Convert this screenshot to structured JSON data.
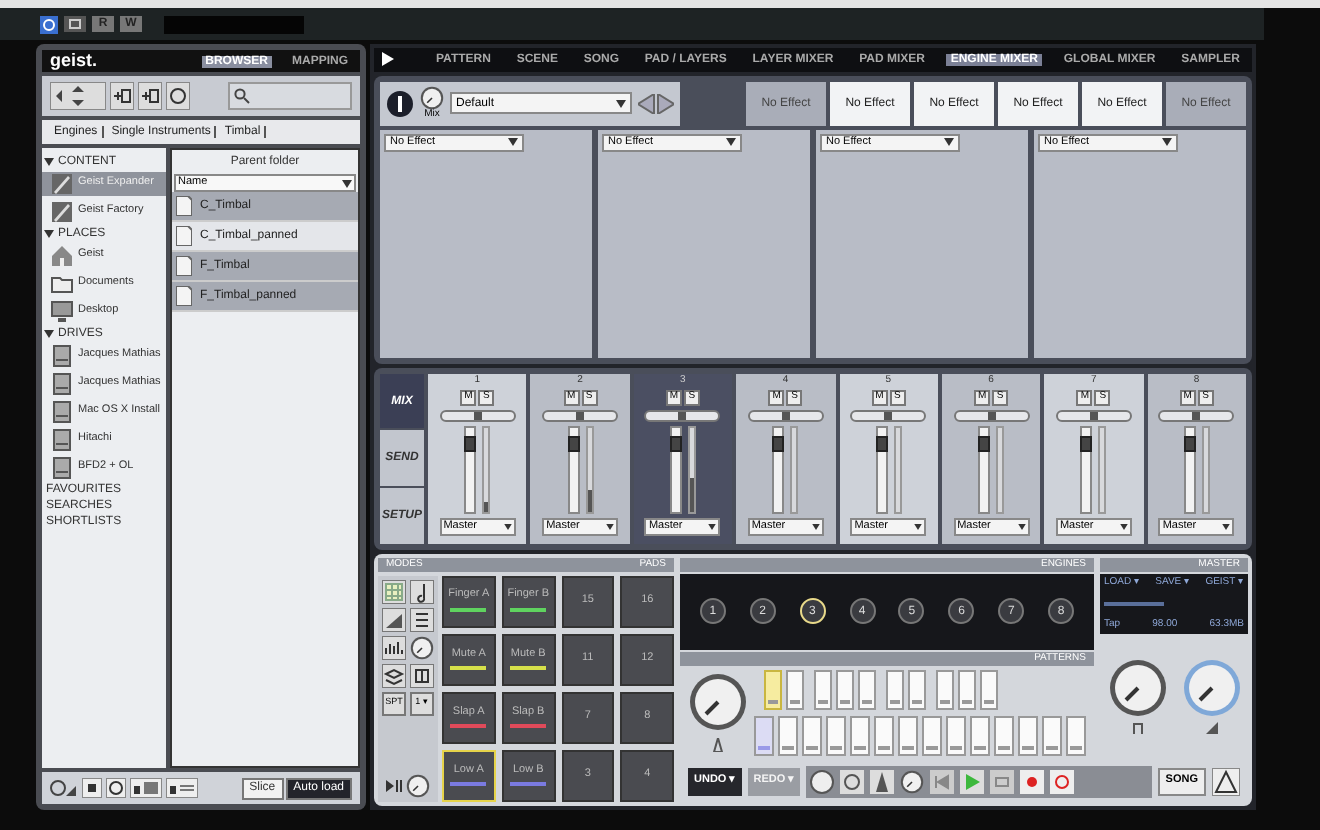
{
  "host_toolbar": {
    "buttons": [
      "R",
      "W"
    ]
  },
  "browser": {
    "logo": "geist.",
    "tabs": [
      {
        "label": "BROWSER",
        "selected": true
      },
      {
        "label": "MAPPING",
        "selected": false
      }
    ],
    "breadcrumbs": [
      "Engines",
      "Single Instruments",
      "Timbal"
    ],
    "sections": [
      {
        "title": "CONTENT",
        "expanded": true,
        "items": [
          {
            "label": "Geist Expander",
            "kind": "content",
            "selected": true
          },
          {
            "label": "Geist Factory",
            "kind": "content",
            "selected": false
          }
        ]
      },
      {
        "title": "PLACES",
        "expanded": true,
        "items": [
          {
            "label": "Geist",
            "kind": "home",
            "selected": false
          },
          {
            "label": "Documents",
            "kind": "folder",
            "selected": false
          },
          {
            "label": "Desktop",
            "kind": "desktop",
            "selected": false
          }
        ]
      },
      {
        "title": "DRIVES",
        "expanded": true,
        "items": [
          {
            "label": "Jacques Mathias",
            "kind": "drive",
            "selected": false
          },
          {
            "label": "Jacques Mathias",
            "kind": "drive",
            "selected": false
          },
          {
            "label": "Mac OS X Install",
            "kind": "drive",
            "selected": false
          },
          {
            "label": "Hitachi",
            "kind": "drive",
            "selected": false
          },
          {
            "label": "BFD2 + OL",
            "kind": "drive",
            "selected": false
          }
        ]
      },
      {
        "title": "FAVOURITES",
        "expanded": false
      },
      {
        "title": "SEARCHES",
        "expanded": false
      },
      {
        "title": "SHORTLISTS",
        "expanded": false
      }
    ],
    "file_list": {
      "header": "Parent folder",
      "sort": "Name",
      "files": [
        {
          "name": "C_Timbal",
          "selected": true
        },
        {
          "name": "C_Timbal_panned",
          "selected": false
        },
        {
          "name": "F_Timbal",
          "selected": true
        },
        {
          "name": "F_Timbal_panned",
          "selected": true
        }
      ]
    },
    "footer_buttons": [
      {
        "label": "Slice",
        "on": false
      },
      {
        "label": "Auto load",
        "on": true
      }
    ]
  },
  "main_tabs": [
    {
      "label": "PATTERN",
      "selected": false
    },
    {
      "label": "SCENE",
      "selected": false
    },
    {
      "label": "SONG",
      "selected": false
    },
    {
      "label": "PAD / LAYERS",
      "selected": false
    },
    {
      "label": "LAYER MIXER",
      "selected": false
    },
    {
      "label": "PAD MIXER",
      "selected": false
    },
    {
      "label": "ENGINE MIXER",
      "selected": true
    },
    {
      "label": "GLOBAL MIXER",
      "selected": false
    },
    {
      "label": "SAMPLER",
      "selected": false
    }
  ],
  "effects": {
    "mix_label": "Mix",
    "preset": "Default",
    "slots": [
      {
        "label": "No Effect",
        "selected": true
      },
      {
        "label": "No Effect",
        "selected": false
      },
      {
        "label": "No Effect",
        "selected": false
      },
      {
        "label": "No Effect",
        "selected": false
      },
      {
        "label": "No Effect",
        "selected": false
      },
      {
        "label": "No Effect",
        "selected": true
      }
    ],
    "panels": [
      {
        "effect": "No Effect"
      },
      {
        "effect": "No Effect"
      },
      {
        "effect": "No Effect"
      },
      {
        "effect": "No Effect"
      }
    ]
  },
  "mixer": {
    "side_tabs": [
      {
        "label": "MIX",
        "selected": true
      },
      {
        "label": "SEND",
        "selected": false
      },
      {
        "label": "SETUP",
        "selected": false
      }
    ],
    "channels": [
      {
        "number": "1",
        "mute": "M",
        "solo": "S",
        "output": "Master",
        "selected": false,
        "pan": {
          "level": 0.5
        },
        "fader": {
          "level": 0.8
        },
        "meter": {
          "level": 0.12
        }
      },
      {
        "number": "2",
        "mute": "M",
        "solo": "S",
        "output": "Master",
        "selected": false,
        "pan": {
          "level": 0.5
        },
        "fader": {
          "level": 0.8
        },
        "meter": {
          "level": 0.25
        }
      },
      {
        "number": "3",
        "mute": "M",
        "solo": "S",
        "output": "Master",
        "selected": true,
        "pan": {
          "level": 0.5
        },
        "fader": {
          "level": 0.8
        },
        "meter": {
          "level": 0.4
        }
      },
      {
        "number": "4",
        "mute": "M",
        "solo": "S",
        "output": "Master",
        "selected": false,
        "pan": {
          "level": 0.5
        },
        "fader": {
          "level": 0.8
        }
      },
      {
        "number": "5",
        "mute": "M",
        "solo": "S",
        "output": "Master",
        "selected": false,
        "pan": {
          "level": 0.5
        },
        "fader": {
          "level": 0.8
        }
      },
      {
        "number": "6",
        "mute": "M",
        "solo": "S",
        "output": "Master",
        "selected": false,
        "pan": {
          "level": 0.5
        },
        "fader": {
          "level": 0.8
        }
      },
      {
        "number": "7",
        "mute": "M",
        "solo": "S",
        "output": "Master",
        "selected": false,
        "pan": {
          "level": 0.5
        },
        "fader": {
          "level": 0.8
        }
      },
      {
        "number": "8",
        "mute": "M",
        "solo": "S",
        "output": "Master",
        "selected": false,
        "pan": {
          "level": 0.5
        },
        "fader": {
          "level": 0.8
        }
      }
    ]
  },
  "modes": {
    "title": "MODES",
    "text_buttons": [
      "SPT",
      "1 ▾"
    ]
  },
  "pads": {
    "title": "PADS",
    "items": [
      {
        "label": "Finger A",
        "color": "#5fd35f",
        "selected": false
      },
      {
        "label": "Finger B",
        "color": "#5fd35f",
        "selected": false
      },
      {
        "label": "15",
        "selected": false
      },
      {
        "label": "16",
        "selected": false
      },
      {
        "label": "Mute A",
        "color": "#d6e04a",
        "selected": false
      },
      {
        "label": "Mute B",
        "color": "#d6e04a",
        "selected": false
      },
      {
        "label": "11",
        "selected": false
      },
      {
        "label": "12",
        "selected": false
      },
      {
        "label": "Slap A",
        "color": "#e04a5a",
        "selected": false
      },
      {
        "label": "Slap B",
        "color": "#e04a5a",
        "selected": false
      },
      {
        "label": "7",
        "selected": false
      },
      {
        "label": "8",
        "selected": false
      },
      {
        "label": "Low A",
        "color": "#7a7ae0",
        "selected": true
      },
      {
        "label": "Low B",
        "color": "#7a7ae0",
        "selected": false
      },
      {
        "label": "3",
        "selected": false
      },
      {
        "label": "4",
        "selected": false
      }
    ]
  },
  "engines": {
    "title": "ENGINES",
    "items": [
      {
        "label": "1",
        "selected": false
      },
      {
        "label": "2",
        "selected": false
      },
      {
        "label": "3",
        "selected": true
      },
      {
        "label": "4",
        "selected": false
      },
      {
        "label": "5",
        "selected": false
      },
      {
        "label": "6",
        "selected": false
      },
      {
        "label": "7",
        "selected": false
      },
      {
        "label": "8",
        "selected": false
      }
    ]
  },
  "patterns": {
    "title": "PATTERNS",
    "top_groups": [
      [
        {
          "selected": true
        },
        {
          "selected": false
        }
      ],
      [
        {
          "selected": false
        },
        {
          "selected": false
        },
        {
          "selected": false
        }
      ],
      [
        {
          "selected": false
        },
        {
          "selected": false
        }
      ],
      [
        {
          "selected": false
        },
        {
          "selected": false
        },
        {
          "selected": false
        }
      ]
    ],
    "bottom_row": [
      {
        "playing": true
      },
      {
        "playing": false
      },
      {
        "playing": false
      },
      {
        "playing": false
      },
      {
        "playing": false
      },
      {
        "playing": false
      },
      {
        "playing": false
      },
      {
        "playing": false
      },
      {
        "playing": false
      },
      {
        "playing": false
      },
      {
        "playing": false
      },
      {
        "playing": false
      },
      {
        "playing": false
      },
      {
        "playing": false
      }
    ]
  },
  "master": {
    "title": "MASTER",
    "menus": [
      "LOAD ▾",
      "SAVE ▾",
      "GEIST ▾"
    ],
    "tap": "Tap",
    "tempo": "98.00",
    "memory": "63.3MB"
  },
  "transport": {
    "undo": {
      "label": "UNDO ▾",
      "disabled": false
    },
    "redo": {
      "label": "REDO ▾",
      "disabled": true
    },
    "song": "SONG"
  }
}
